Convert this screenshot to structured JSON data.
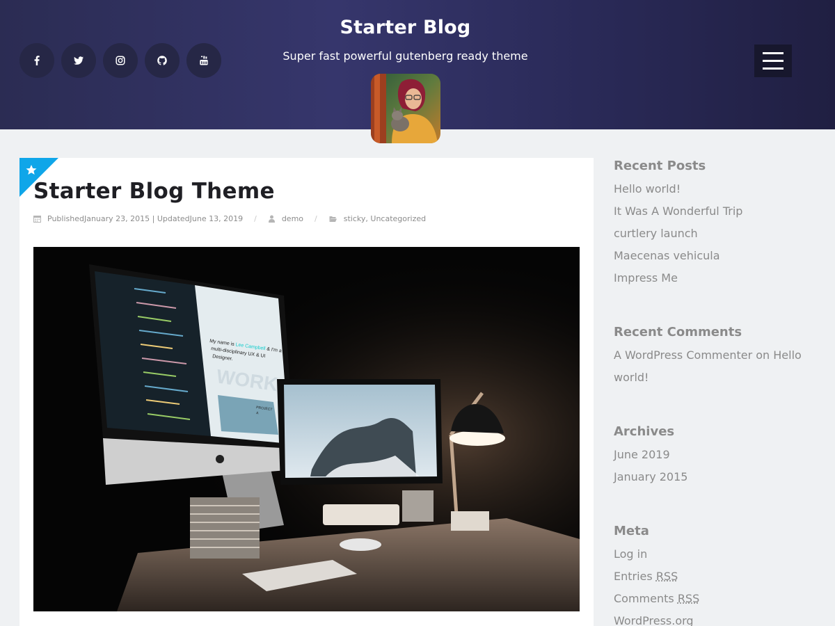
{
  "header": {
    "site_title": "Starter Blog",
    "tagline": "Super fast powerful gutenberg ready theme",
    "social_icons": [
      "facebook-icon",
      "twitter-icon",
      "instagram-icon",
      "github-icon",
      "youtube-icon"
    ],
    "colors": {
      "header_bg": "#2b2c53",
      "social_bg": "#262746",
      "menu_bg": "#17172d"
    }
  },
  "article": {
    "title": "Starter Blog Theme",
    "meta": {
      "date_text": "PublishedJanuary 23, 2015 | UpdatedJune 13, 2019",
      "author": "demo",
      "category_1": "sticky",
      "category_sep": ",",
      "category_2": "Uncategorized"
    },
    "ribbon_color": "#0fa6e9",
    "image_alt": "Desk with iMac showing code, monitor with mountain photo and desk lamp",
    "image_screen_text": {
      "intro_1": "My name is ",
      "intro_name": "Lee Campbell",
      "intro_2": " & I'm a",
      "line_2": "multi-disciplinary UX & UI",
      "line_3": "Designer.",
      "work": "WORK",
      "project_1": "PROJECT",
      "project_2": "A"
    }
  },
  "sidebar": {
    "recent_posts": {
      "title": "Recent Posts",
      "items": [
        "Hello world!",
        "It Was A Wonderful Trip",
        "curtlery launch",
        "Maecenas vehicula",
        "Impress Me"
      ]
    },
    "recent_comments": {
      "title": "Recent Comments",
      "line_1": "A WordPress Commenter on Hello",
      "line_2": "world!"
    },
    "archives": {
      "title": "Archives",
      "items": [
        "June 2019",
        "January 2015"
      ]
    },
    "meta": {
      "title": "Meta",
      "login": "Log in",
      "entries_label": "Entries ",
      "comments_label": "Comments ",
      "rss": "RSS",
      "wordpress_org": "WordPress.org"
    }
  }
}
